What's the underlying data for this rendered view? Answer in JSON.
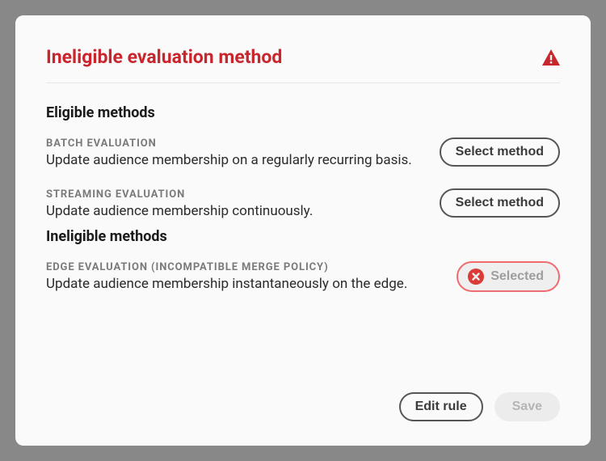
{
  "dialog": {
    "title": "Ineligible evaluation method"
  },
  "eligible": {
    "heading": "Eligible methods",
    "methods": [
      {
        "label": "BATCH EVALUATION",
        "description": "Update audience membership on a regularly recurring basis.",
        "button": "Select method"
      },
      {
        "label": "STREAMING EVALUATION",
        "description": "Update audience membership continuously.",
        "button": "Select method"
      }
    ]
  },
  "ineligible": {
    "heading": "Ineligible methods",
    "methods": [
      {
        "label": "EDGE EVALUATION (INCOMPATIBLE MERGE POLICY)",
        "description": "Update audience membership instantaneously on the edge.",
        "button": "Selected"
      }
    ]
  },
  "footer": {
    "edit": "Edit rule",
    "save": "Save"
  },
  "colors": {
    "error": "#c9252d",
    "errorIcon": "#da3b36"
  }
}
